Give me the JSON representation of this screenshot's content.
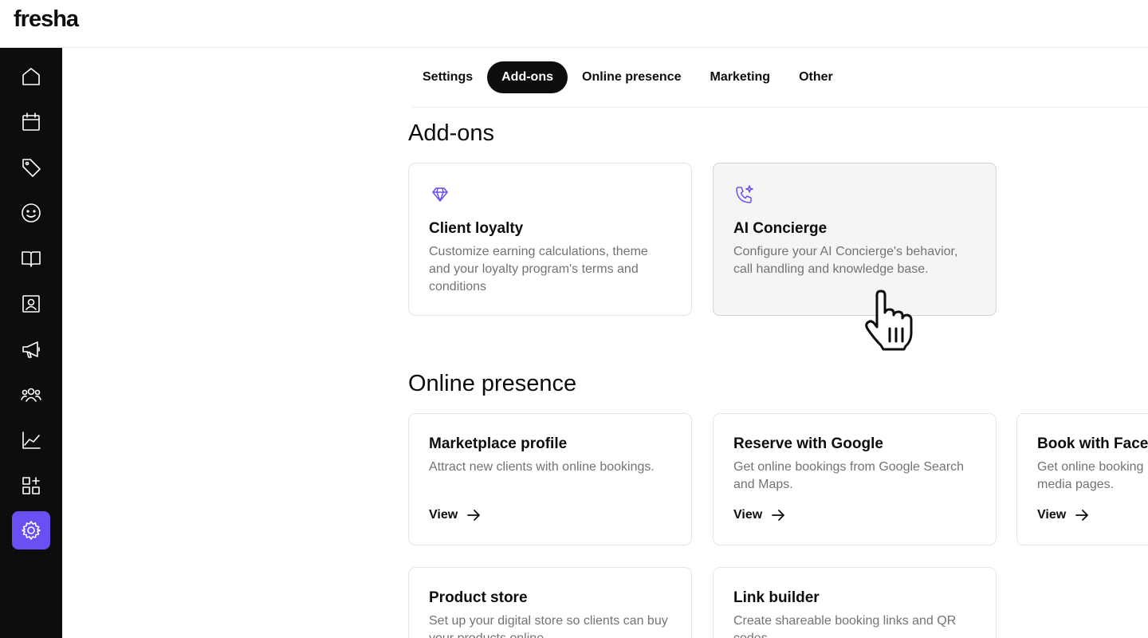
{
  "app": {
    "logo": "fresha"
  },
  "sidebar": {
    "items": [
      {
        "name": "home",
        "icon": "home-icon"
      },
      {
        "name": "calendar",
        "icon": "calendar-icon"
      },
      {
        "name": "sales",
        "icon": "tag-icon"
      },
      {
        "name": "clients",
        "icon": "smiley-icon"
      },
      {
        "name": "catalog",
        "icon": "book-icon"
      },
      {
        "name": "team",
        "icon": "contact-card-icon"
      },
      {
        "name": "marketing",
        "icon": "megaphone-icon"
      },
      {
        "name": "team-members",
        "icon": "people-icon"
      },
      {
        "name": "reports",
        "icon": "chart-icon"
      },
      {
        "name": "apps",
        "icon": "add-apps-icon"
      },
      {
        "name": "settings",
        "icon": "gear-icon",
        "active": true
      }
    ]
  },
  "tabs": [
    {
      "label": "Settings"
    },
    {
      "label": "Add-ons",
      "active": true
    },
    {
      "label": "Online presence"
    },
    {
      "label": "Marketing"
    },
    {
      "label": "Other"
    }
  ],
  "addons": {
    "title": "Add-ons",
    "cards": [
      {
        "icon": "diamond-icon",
        "title": "Client loyalty",
        "desc": "Customize earning calculations, theme and your loyalty program's terms and conditions"
      },
      {
        "icon": "phone-sparkle-icon",
        "title": "AI Concierge",
        "desc": "Configure your AI Concierge's behavior, call handling and knowledge base."
      }
    ]
  },
  "online_presence": {
    "title": "Online presence",
    "cards": [
      {
        "title": "Marketplace profile",
        "desc": "Attract new clients with online bookings.",
        "link": "View"
      },
      {
        "title": "Reserve with Google",
        "desc": "Get online bookings from Google Search and Maps.",
        "link": "View"
      },
      {
        "title": "Book with Faceb",
        "desc": "Get online booking media pages.",
        "link": "View"
      },
      {
        "title": "Product store",
        "desc": "Set up your digital store so clients can buy your products online."
      },
      {
        "title": "Link builder",
        "desc": "Create shareable booking links and QR codes."
      }
    ]
  },
  "colors": {
    "accent": "#6950f3",
    "sidebar_bg": "#0d0d0d",
    "muted_text": "#737373"
  }
}
